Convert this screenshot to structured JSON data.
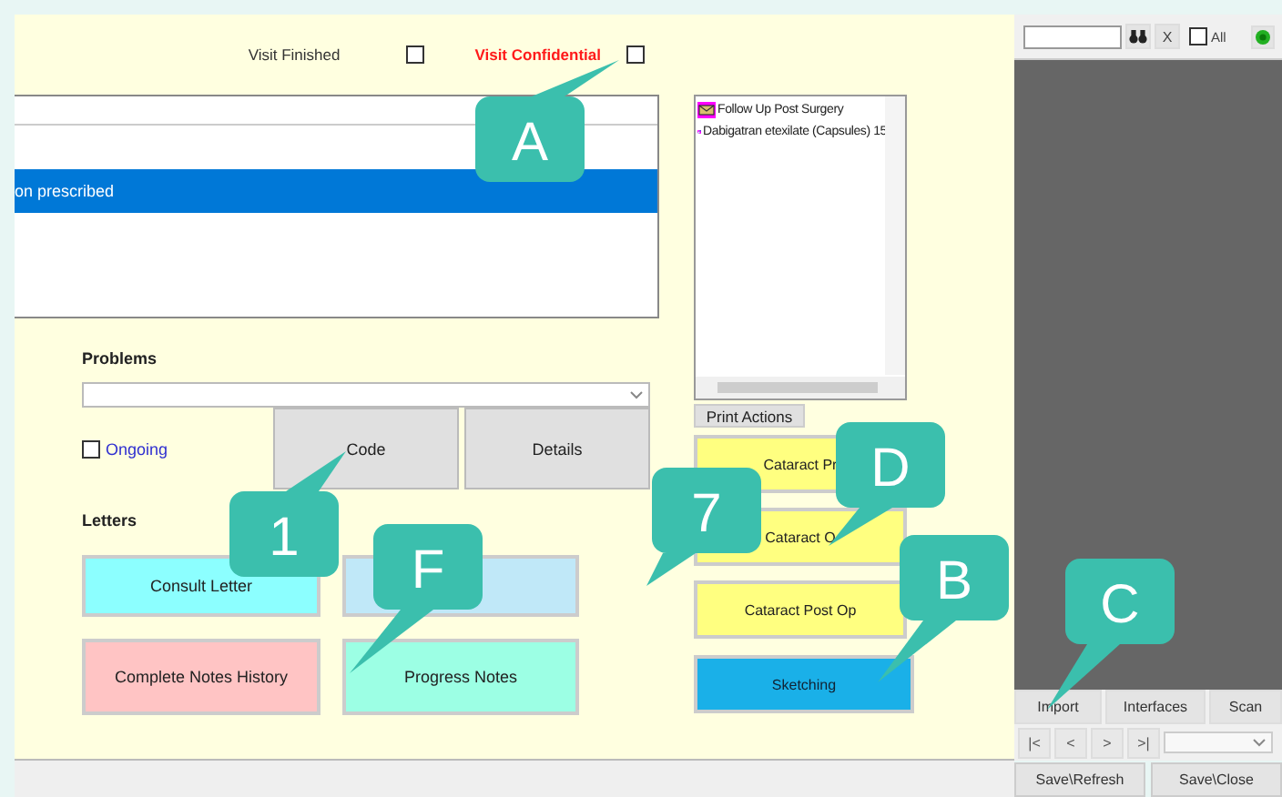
{
  "visit_flags": [
    {
      "label": "Visit Finished",
      "kind": "normal",
      "checked": false
    },
    {
      "label": "Visit Confidential",
      "kind": "warning",
      "checked": false
    }
  ],
  "visit_list": {
    "rows": [
      {
        "text": "on prescribed",
        "selected": true
      }
    ]
  },
  "problems": {
    "label": "Problems",
    "ongoing": {
      "label": "Ongoing",
      "checked": false
    },
    "buttons": [
      "Code",
      "Details"
    ]
  },
  "letters": {
    "label": "Letters",
    "buttons": [
      {
        "label": "Consult Letter",
        "color": "#8cffff"
      },
      {
        "color": "#c0e8f8"
      },
      {
        "label": "Complete Notes History",
        "color": "#ffc4c4"
      },
      {
        "label": "Progress Notes",
        "color": "#9cffe4"
      }
    ]
  },
  "actions_list": {
    "items": [
      {
        "text": "Follow Up Post Surgery",
        "kind": "letter"
      },
      {
        "text": "Dabigatran etexilate (Capsules) 15",
        "kind": "drug"
      }
    ]
  },
  "print_actions": "Print Actions",
  "action_buttons": [
    {
      "label": "Cataract Pr",
      "kind": "plain"
    },
    {
      "label": "Cataract O",
      "kind": "plain"
    },
    {
      "label": "Cataract Post Op",
      "kind": "plain"
    },
    {
      "label": "Sketching",
      "kind": "primary"
    }
  ],
  "side_panel": {
    "clear": "X",
    "all": {
      "label": "All",
      "checked": false
    },
    "buttons": [
      "Import",
      "Interfaces",
      "Scan"
    ],
    "nav": [
      "|<",
      "<",
      ">",
      ">|"
    ],
    "save_buttons": [
      "Save\\Refresh",
      "Save\\Close"
    ]
  },
  "callouts": [
    "A",
    "1",
    "F",
    "7",
    "D",
    "B",
    "C"
  ]
}
